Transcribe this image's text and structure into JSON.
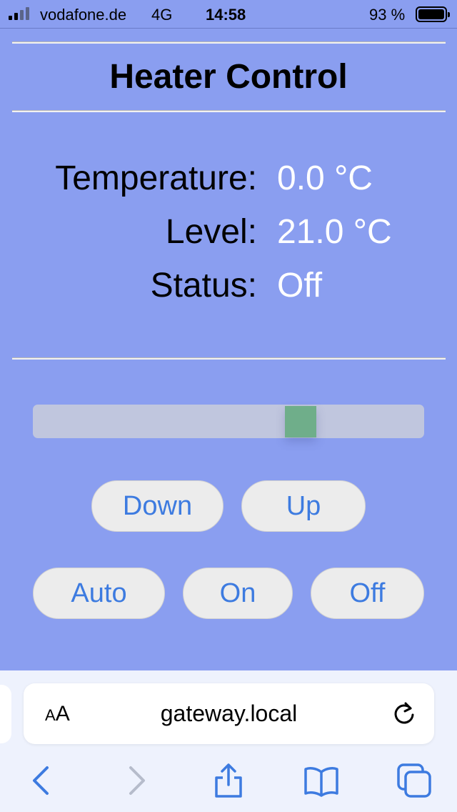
{
  "status_bar": {
    "carrier": "vodafone.de",
    "network": "4G",
    "time": "14:58",
    "battery": "93 %",
    "battery_level": 0.93
  },
  "page": {
    "title": "Heater Control",
    "readings": [
      {
        "label": "Temperature:",
        "value": "0.0 °C"
      },
      {
        "label": "Level:",
        "value": "21.0 °C"
      },
      {
        "label": "Status:",
        "value": "Off"
      }
    ],
    "slider": {
      "level": 0.67
    },
    "buttons": {
      "down": "Down",
      "up": "Up",
      "auto": "Auto",
      "on": "On",
      "off": "Off"
    }
  },
  "browser": {
    "text_size_small": "A",
    "text_size_large": "A",
    "url": "gateway.local"
  },
  "colors": {
    "page_background": "#8a9ef0",
    "button_text": "#3d7be0",
    "slider_thumb": "#6fae8a",
    "value_text": "#ffffff"
  }
}
